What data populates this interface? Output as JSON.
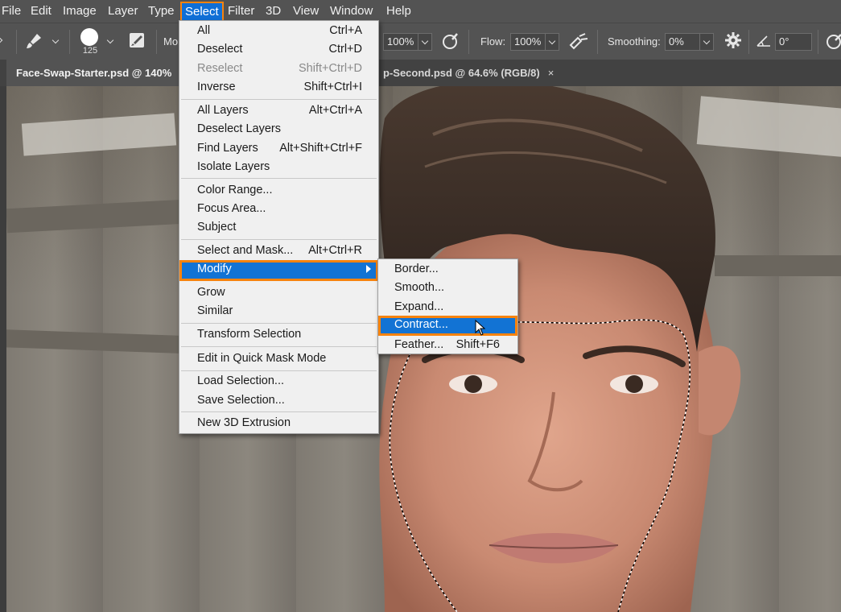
{
  "menubar": {
    "items": [
      "File",
      "Edit",
      "Image",
      "Layer",
      "Type",
      "Select",
      "Filter",
      "3D",
      "View",
      "Window",
      "Help"
    ],
    "active": "Select"
  },
  "options": {
    "brush_size": "125",
    "mode_label": "Mo",
    "opacity_value": "100%",
    "flow_label": "Flow:",
    "flow_value": "100%",
    "smoothing_label": "Smoothing:",
    "smoothing_value": "0%",
    "angle_value": "0°"
  },
  "tabs": [
    {
      "label": "Face-Swap-Starter.psd @ 140%"
    },
    {
      "label": "p-Second.psd @ 64.6% (RGB/8)",
      "close": "×"
    }
  ],
  "select_menu": {
    "items": [
      {
        "label": "All",
        "shortcut": "Ctrl+A"
      },
      {
        "label": "Deselect",
        "shortcut": "Ctrl+D"
      },
      {
        "label": "Reselect",
        "shortcut": "Shift+Ctrl+D",
        "disabled": true
      },
      {
        "label": "Inverse",
        "shortcut": "Shift+Ctrl+I"
      },
      {
        "label": "All Layers",
        "shortcut": "Alt+Ctrl+A"
      },
      {
        "label": "Deselect Layers",
        "shortcut": ""
      },
      {
        "label": "Find Layers",
        "shortcut": "Alt+Shift+Ctrl+F"
      },
      {
        "label": "Isolate Layers",
        "shortcut": ""
      },
      {
        "label": "Color Range...",
        "shortcut": ""
      },
      {
        "label": "Focus Area...",
        "shortcut": ""
      },
      {
        "label": "Subject",
        "shortcut": ""
      },
      {
        "label": "Select and Mask...",
        "shortcut": "Alt+Ctrl+R"
      },
      {
        "label": "Modify",
        "shortcut": "",
        "highlighted": true
      },
      {
        "label": "Grow",
        "shortcut": ""
      },
      {
        "label": "Similar",
        "shortcut": ""
      },
      {
        "label": "Transform Selection",
        "shortcut": ""
      },
      {
        "label": "Edit in Quick Mask Mode",
        "shortcut": ""
      },
      {
        "label": "Load Selection...",
        "shortcut": ""
      },
      {
        "label": "Save Selection...",
        "shortcut": ""
      },
      {
        "label": "New 3D Extrusion",
        "shortcut": ""
      }
    ]
  },
  "modify_submenu": {
    "items": [
      {
        "label": "Border...",
        "shortcut": ""
      },
      {
        "label": "Smooth...",
        "shortcut": ""
      },
      {
        "label": "Expand...",
        "shortcut": ""
      },
      {
        "label": "Contract...",
        "shortcut": "",
        "highlighted": true
      },
      {
        "label": "Feather...",
        "shortcut": "Shift+F6"
      }
    ]
  },
  "colors": {
    "highlight": "#1273d4",
    "callout_border": "#f7830e",
    "menu_bg": "#f0f0f0",
    "app_bg": "#535353"
  },
  "icons": {
    "brush_tool": "brush-icon",
    "brush_settings": "brush-settings-icon",
    "pressure_opacity": "pressure-opacity-icon",
    "airbrush": "airbrush-icon",
    "smoothing_settings": "gear-icon",
    "angle": "angle-icon",
    "pressure_size": "pressure-size-icon"
  }
}
